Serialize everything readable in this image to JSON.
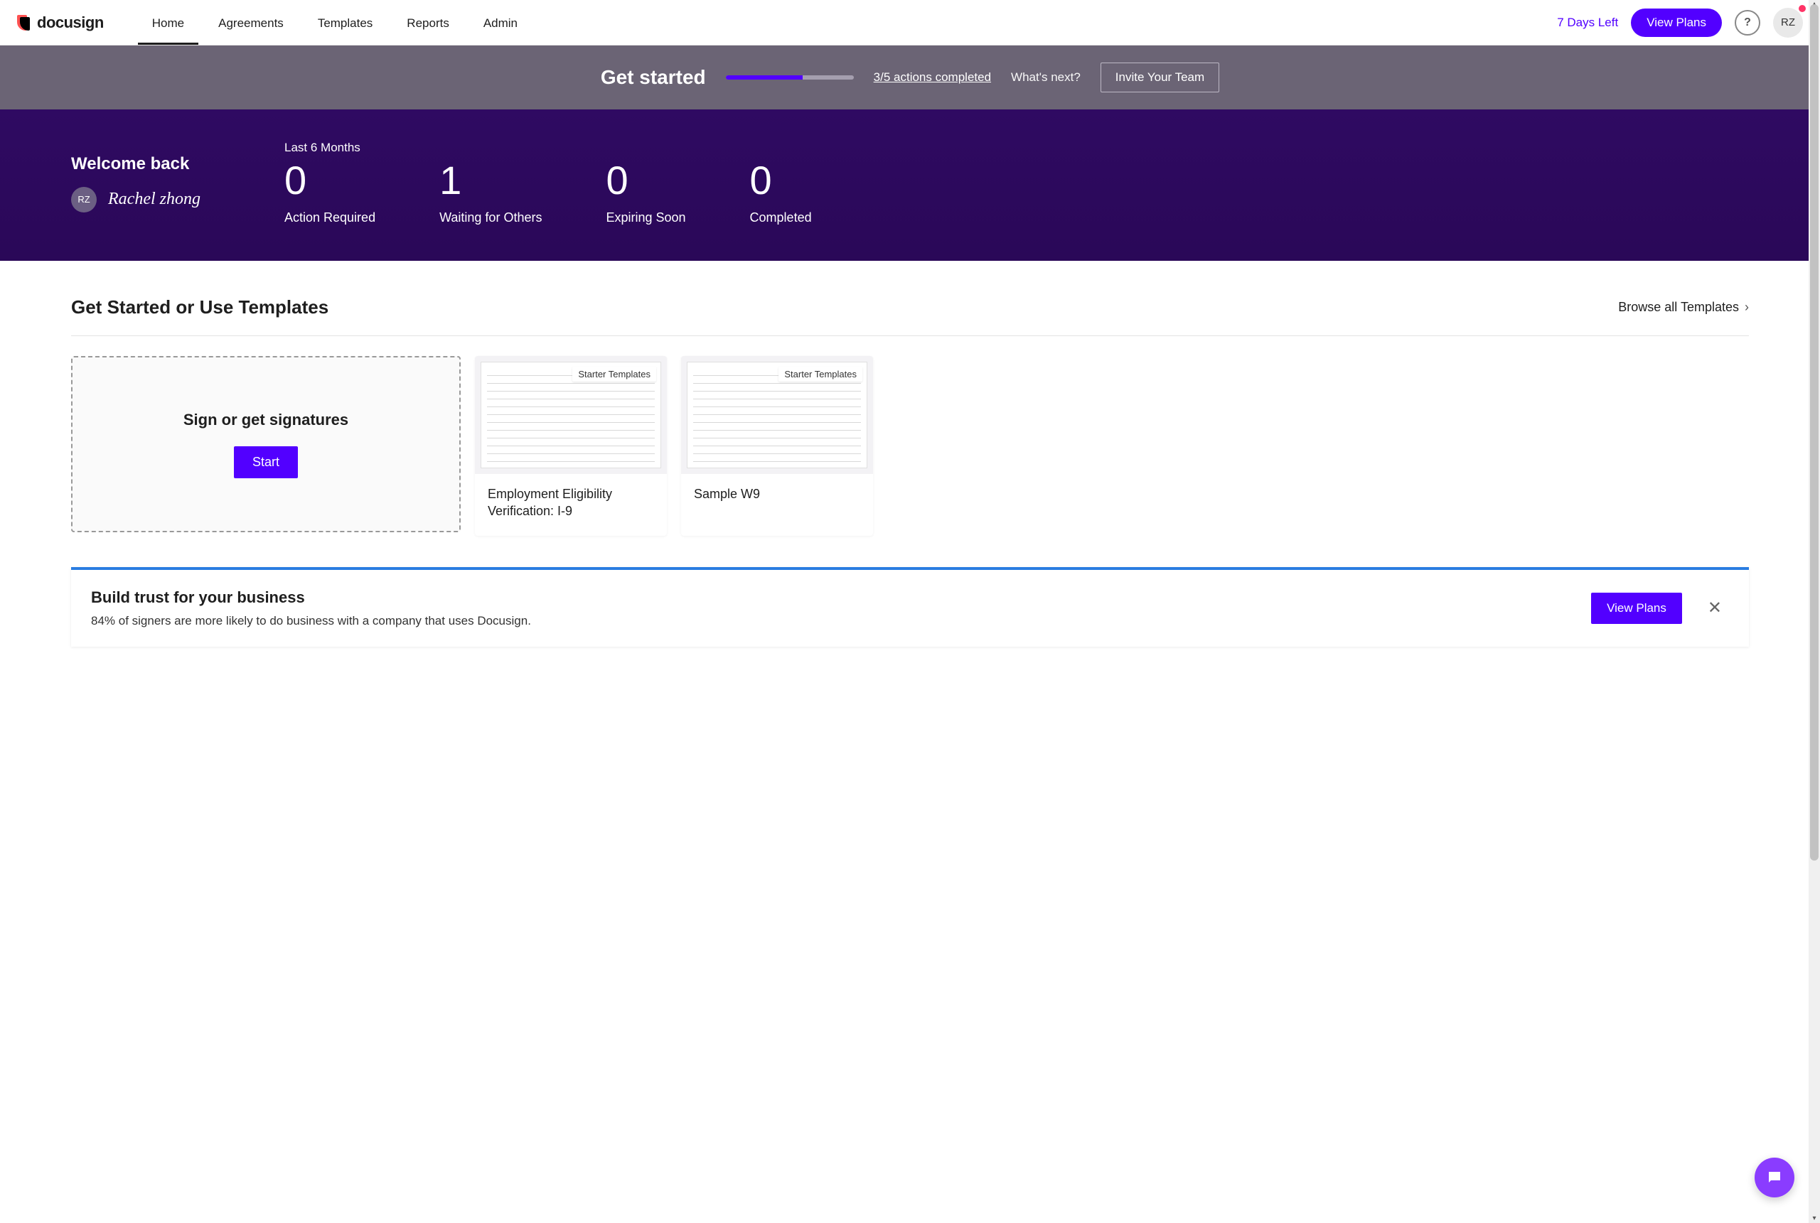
{
  "header": {
    "logo_text": "docusign",
    "nav": [
      "Home",
      "Agreements",
      "Templates",
      "Reports",
      "Admin"
    ],
    "active_nav_index": 0,
    "days_left": "7 Days Left",
    "view_plans": "View Plans",
    "help_symbol": "?",
    "avatar_initials": "RZ"
  },
  "getstarted": {
    "title": "Get started",
    "progress_percent": 60,
    "progress_label": "3/5 actions completed",
    "next_label": "What's next?",
    "invite_label": "Invite Your Team"
  },
  "welcome": {
    "title": "Welcome back",
    "avatar_initials": "RZ",
    "signature": "Rachel zhong",
    "period": "Last 6 Months",
    "stats": [
      {
        "value": "0",
        "label": "Action Required"
      },
      {
        "value": "1",
        "label": "Waiting for Others"
      },
      {
        "value": "0",
        "label": "Expiring Soon"
      },
      {
        "value": "0",
        "label": "Completed"
      }
    ]
  },
  "content": {
    "title": "Get Started or Use Templates",
    "browse": "Browse all Templates",
    "sign_card_title": "Sign or get signatures",
    "start_label": "Start",
    "template_badge": "Starter Templates",
    "templates": [
      {
        "title": "Employment Eligibility Verification: I-9"
      },
      {
        "title": "Sample W9"
      }
    ]
  },
  "promo": {
    "title": "Build trust for your business",
    "subtitle": "84% of signers are more likely to do business with a company that uses Docusign.",
    "cta": "View Plans"
  }
}
